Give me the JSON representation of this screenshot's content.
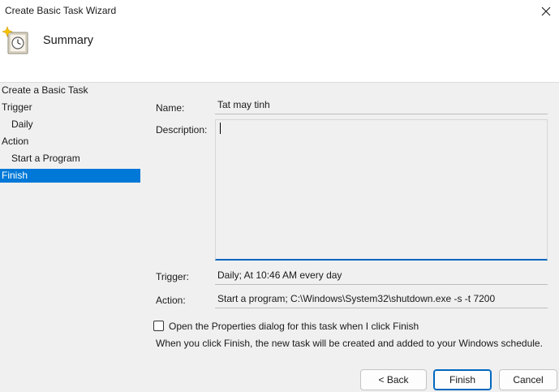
{
  "window": {
    "title": "Create Basic Task Wizard"
  },
  "header": {
    "title": "Summary",
    "icon": "task-scheduler-clock-icon"
  },
  "nav": {
    "items": [
      {
        "label": "Create a Basic Task"
      },
      {
        "label": "Trigger"
      },
      {
        "label": "Daily"
      },
      {
        "label": "Action"
      },
      {
        "label": "Start a Program"
      },
      {
        "label": "Finish"
      }
    ],
    "active": "Finish"
  },
  "summary": {
    "name_label": "Name:",
    "name_value": "Tat may tinh",
    "description_label": "Description:",
    "description_value": "",
    "trigger_label": "Trigger:",
    "trigger_value": "Daily; At 10:46 AM every day",
    "action_label": "Action:",
    "action_value": "Start a program; C:\\Windows\\System32\\shutdown.exe -s -t 7200"
  },
  "options": {
    "open_properties_label": "Open the Properties dialog for this task when I click Finish",
    "open_properties_checked": false,
    "note": "When you click Finish, the new task will be created and added to your Windows schedule."
  },
  "buttons": {
    "back": "< Back",
    "finish": "Finish",
    "cancel": "Cancel"
  },
  "colors": {
    "accent": "#0078d7",
    "focus_border": "#0067c0"
  }
}
